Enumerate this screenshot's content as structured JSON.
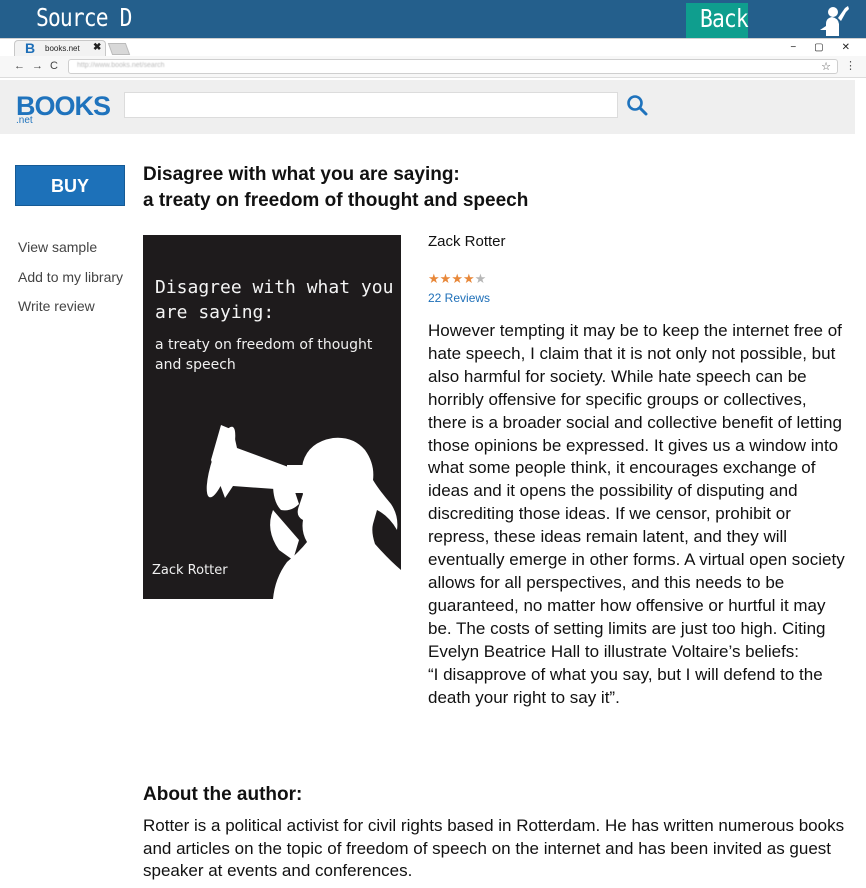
{
  "banner": {
    "source_label": "Source D",
    "back_label": "Back",
    "accent_color": "#245f8c",
    "back_color": "#0f9e8e",
    "corner_icon": "person-raising-hand-icon"
  },
  "browser": {
    "tab_logo": "B",
    "tab_title": "books.net",
    "tab_close": "✖",
    "nav_back": "←",
    "nav_forward": "→",
    "nav_reload": "C",
    "url": "http://www.books.net/search",
    "window_controls": [
      "−",
      "▢",
      "✕"
    ]
  },
  "site": {
    "logo": "BOOKS",
    "logo_sub": ".net",
    "search_placeholder": "",
    "brand_color": "#1f73bd"
  },
  "sidebar": {
    "buy_label": "BUY",
    "links": [
      "View sample",
      "Add to my library",
      "Write review"
    ]
  },
  "book": {
    "title_line1": "Disagree with what you are saying:",
    "title_line2": "a treaty on freedom of thought and speech",
    "cover_title": "Disagree with what you are saying:",
    "cover_subtitle": "a treaty on freedom of thought and speech",
    "cover_author": "Zack Rotter",
    "author": "Zack Rotter",
    "rating": 4,
    "rating_max": 5,
    "reviews_label": "22 Reviews",
    "description": "However tempting it may be to keep the internet free of hate speech, I claim that it is not only not possible, but also harmful for society. While hate speech can be horribly offensive for specific groups or collectives, there is a broader social and collective benefit of letting those opinions be expressed. It gives us a window into what some people think, it encourages exchange of ideas and it opens the possibility of disputing and discrediting those ideas. If we censor, prohibit or repress, these ideas remain latent, and they will eventually emerge in other forms. A virtual open society allows for all perspectives, and this needs to be guaranteed, no matter how offensive or hurtful it may be. The costs of setting limits are just too high. Citing Evelyn Beatrice Hall to illustrate Voltaire’s beliefs:",
    "quote": "“I disapprove of what you say, but I will defend to the death your right to say it”."
  },
  "about": {
    "heading": "About the author:",
    "text": "Rotter is a political activist for civil rights based in Rotterdam. He has written numerous books and articles on the topic of freedom of speech on the internet and has been invited as guest speaker at events and conferences."
  }
}
